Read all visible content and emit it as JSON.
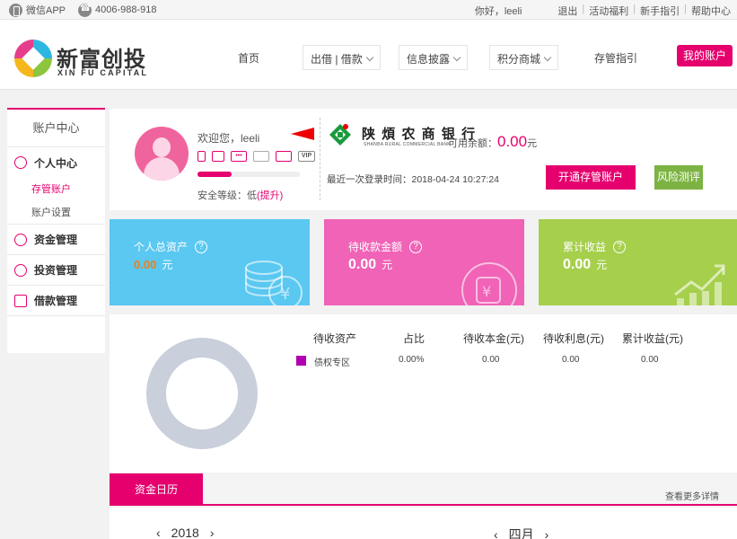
{
  "topbar": {
    "app_label": "微信APP",
    "phone": "4006-988-918",
    "greeting": "你好，leeli",
    "links": [
      "退出",
      "活动福利",
      "新手指引",
      "帮助中心"
    ]
  },
  "header": {
    "brand_cn": "新富创投",
    "brand_en": "XIN FU CAPITAL",
    "nav": [
      "首页",
      "出借 | 借款",
      "信息披露",
      "积分商城",
      "存管指引"
    ],
    "my_account": "我的账户"
  },
  "sidebar": {
    "title": "账户中心",
    "groups": [
      {
        "label": "个人中心",
        "icon": "user-icon",
        "subs": [
          "存管账户",
          "账户设置"
        ]
      },
      {
        "label": "资金管理",
        "icon": "yuan-icon"
      },
      {
        "label": "投资管理",
        "icon": "invest-icon"
      },
      {
        "label": "借款管理",
        "icon": "wallet-icon"
      }
    ]
  },
  "account": {
    "welcome": "欢迎您，leeli",
    "security_level": 0.33,
    "security_text": "安全等级：低",
    "security_upgrade": "(提升)",
    "vip": "VIP",
    "bank_name": "陕 煩 农 商 银 行",
    "bank_en": "SHANBA RURAL COMMERCIAL BANK",
    "available_label": "可用余额：",
    "available_amount": "0.00",
    "available_unit": "元",
    "last_login": "最近一次登录时间：2018-04-24 10:27:24",
    "open_button": "开通存管账户",
    "risk_button": "风险测评"
  },
  "cards": [
    {
      "label": "个人总资产",
      "value": "0.00",
      "unit": "元",
      "color": "#5ac8f1"
    },
    {
      "label": "待收款金额",
      "value": "0.00",
      "unit": "元",
      "color": "#f063b6"
    },
    {
      "label": "累计收益",
      "value": "0.00",
      "unit": "元",
      "color": "#a6cf4c"
    }
  ],
  "assets_table": {
    "headers": [
      "待收资产",
      "占比",
      "待收本金(元)",
      "待收利息(元)",
      "累计收益(元)"
    ],
    "rows": [
      {
        "name": "债权专区",
        "ratio": "0.00%",
        "principal": "0.00",
        "interest": "0.00",
        "earned": "0.00",
        "color": "#b100b1"
      }
    ]
  },
  "calendar": {
    "tab": "资金日历",
    "more": "查看更多详情",
    "year": "2018",
    "month": "四月"
  }
}
